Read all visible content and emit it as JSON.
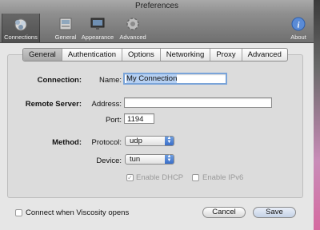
{
  "window": {
    "title": "Preferences"
  },
  "toolbar": {
    "items": [
      {
        "label": "Connections",
        "icon": "connections-icon"
      },
      {
        "label": "General",
        "icon": "general-icon"
      },
      {
        "label": "Appearance",
        "icon": "appearance-icon"
      },
      {
        "label": "Advanced",
        "icon": "advanced-gear-icon"
      },
      {
        "label": "About",
        "icon": "info-icon"
      }
    ]
  },
  "tabs": [
    "General",
    "Authentication",
    "Options",
    "Networking",
    "Proxy",
    "Advanced"
  ],
  "form": {
    "connection_section": "Connection:",
    "name_label": "Name:",
    "name_value": "My Connection",
    "remote_section": "Remote Server:",
    "address_label": "Address:",
    "address_value": "",
    "port_label": "Port:",
    "port_value": "1194",
    "method_section": "Method:",
    "protocol_label": "Protocol:",
    "protocol_value": "udp",
    "device_label": "Device:",
    "device_value": "tun",
    "enable_dhcp": "Enable DHCP",
    "enable_ipv6": "Enable IPv6"
  },
  "footer": {
    "connect_on_open": "Connect when Viscosity opens",
    "cancel_label": "Cancel",
    "save_label": "Save"
  },
  "colors": {
    "accent": "#3a6ec8",
    "selection": "#b6d0f2"
  }
}
